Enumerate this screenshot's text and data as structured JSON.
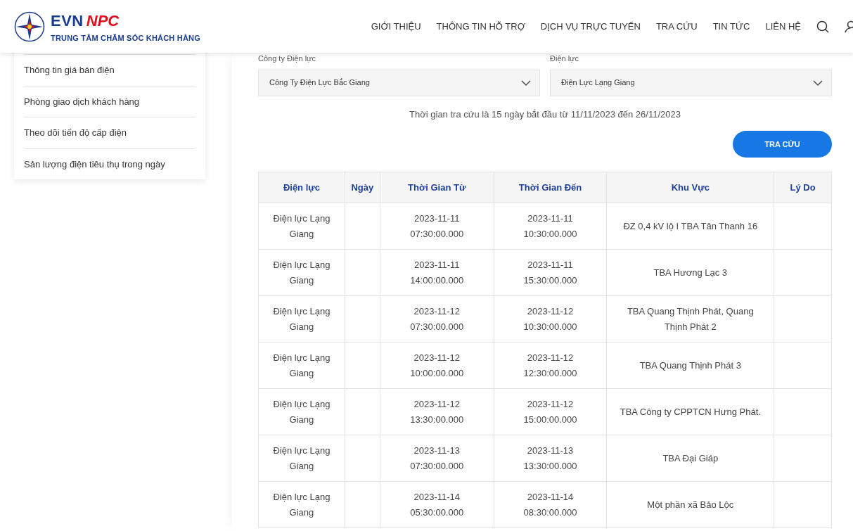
{
  "header": {
    "brand_main": "EVN",
    "brand_accent": "NPC",
    "brand_subtitle": "TRUNG TÂM CHĂM SÓC KHÁCH HÀNG",
    "nav": [
      "GIỚI THIỆU",
      "THÔNG TIN HỖ TRỢ",
      "DỊCH VỤ TRỰC TUYẾN",
      "TRA CỨU",
      "TIN TỨC",
      "LIÊN HỆ"
    ]
  },
  "sidebar": {
    "items": [
      "Thông tin giá bán điện",
      "Phòng giao dịch khách hàng",
      "Theo dõi tiến độ cấp điện",
      "Sản lượng điện tiêu thụ trong ngày"
    ]
  },
  "filters": [
    {
      "label": "Công ty Điện lực",
      "value": "Công Ty Điện Lực Bắc Giang"
    },
    {
      "label": "Điện lực",
      "value": "Điện Lực Lạng Giang"
    }
  ],
  "notice": "Thời gian tra cứu là 15 ngày bắt đầu từ 11/11/2023 đến 26/11/2023",
  "search_button": "TRA CỨU",
  "table": {
    "columns": [
      "Điện lực",
      "Ngày",
      "Thời Gian Từ",
      "Thời Gian Đến",
      "Khu Vực",
      "Lý Do"
    ],
    "rows": [
      [
        "Điện lực Lạng Giang",
        "",
        "2023-11-11 07:30:00.000",
        "2023-11-11 10:30:00.000",
        "ĐZ 0,4 kV lộ I TBA Tân Thanh 16",
        ""
      ],
      [
        "Điện lực Lạng Giang",
        "",
        "2023-11-11 14:00:00.000",
        "2023-11-11 15:30:00.000",
        "TBA Hương Lạc 3",
        ""
      ],
      [
        "Điện lực Lạng Giang",
        "",
        "2023-11-12 07:30:00.000",
        "2023-11-12 10:30:00.000",
        "TBA Quang Thịnh Phát, Quang Thịnh Phát 2",
        ""
      ],
      [
        "Điện lực Lạng Giang",
        "",
        "2023-11-12 10:00:00.000",
        "2023-11-12 12:30:00.000",
        "TBA Quang Thịnh Phát 3",
        ""
      ],
      [
        "Điện lực Lạng Giang",
        "",
        "2023-11-12 13:30:00.000",
        "2023-11-12 15:00:00.000",
        "TBA Công ty CPPTCN Hưng Phát.",
        ""
      ],
      [
        "Điện lực Lạng Giang",
        "",
        "2023-11-13 07:30:00.000",
        "2023-11-13 13:30:00.000",
        "TBA Đại Giáp",
        ""
      ],
      [
        "Điện lực Lạng Giang",
        "",
        "2023-11-14 05:30:00.000",
        "2023-11-14 08:30:00.000",
        "Một phần xã Bảo Lộc",
        ""
      ]
    ]
  }
}
